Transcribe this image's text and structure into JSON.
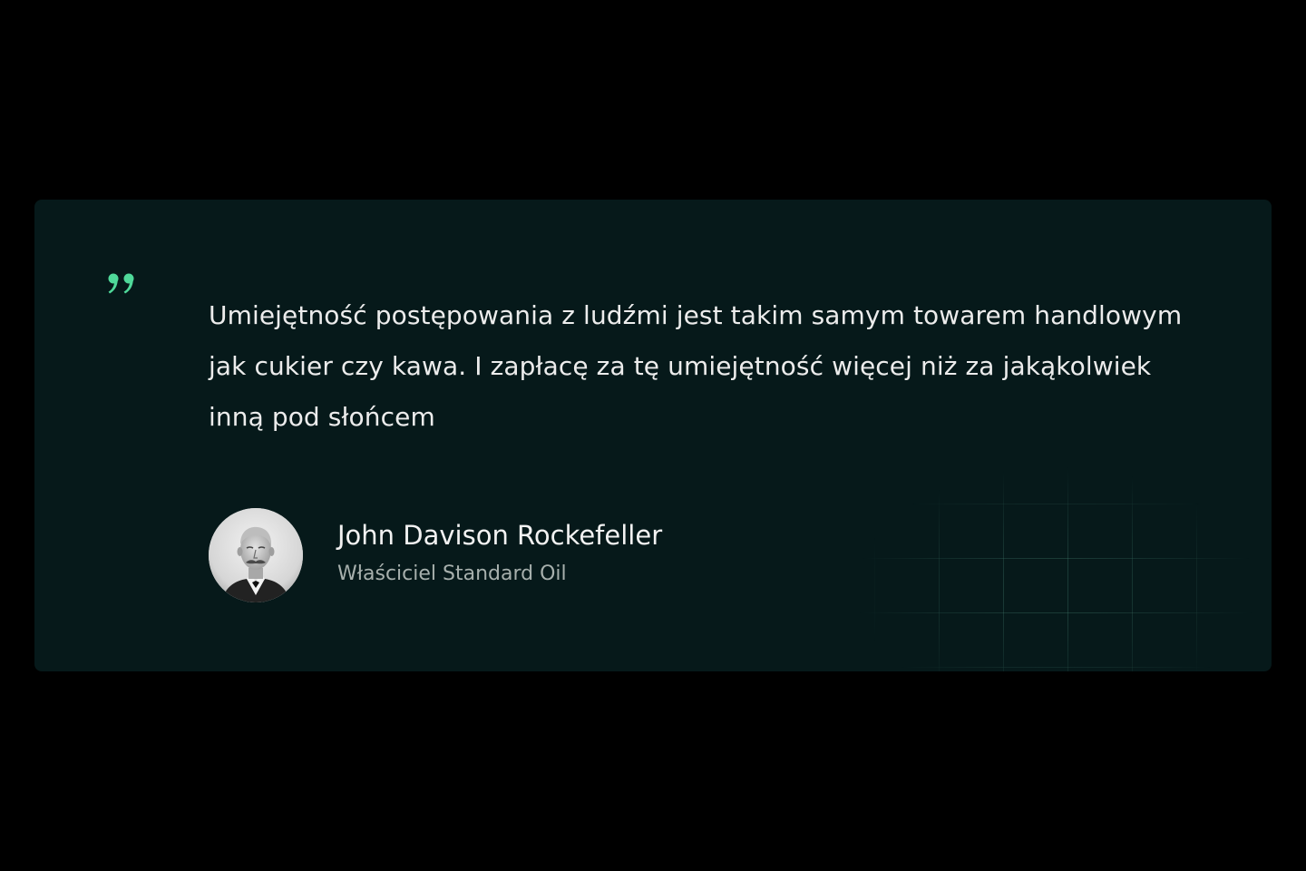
{
  "testimonial": {
    "quote": "Umiejętność postępowania z ludźmi jest takim samym towarem handlowym jak cukier czy kawa. I zapłacę za tę umiejętność więcej niż za jakąkolwiek inną pod słońcem",
    "quote_icon": "quote-mark-icon",
    "author": {
      "name": "John Davison Rockefeller",
      "role": "Właściciel Standard Oil",
      "avatar": "portrait-photo"
    }
  },
  "colors": {
    "page_background": "#000000",
    "card_background": "#06191a",
    "accent": "#4fd99a",
    "text_primary": "#ececec",
    "text_secondary": "#a7b0ad"
  }
}
